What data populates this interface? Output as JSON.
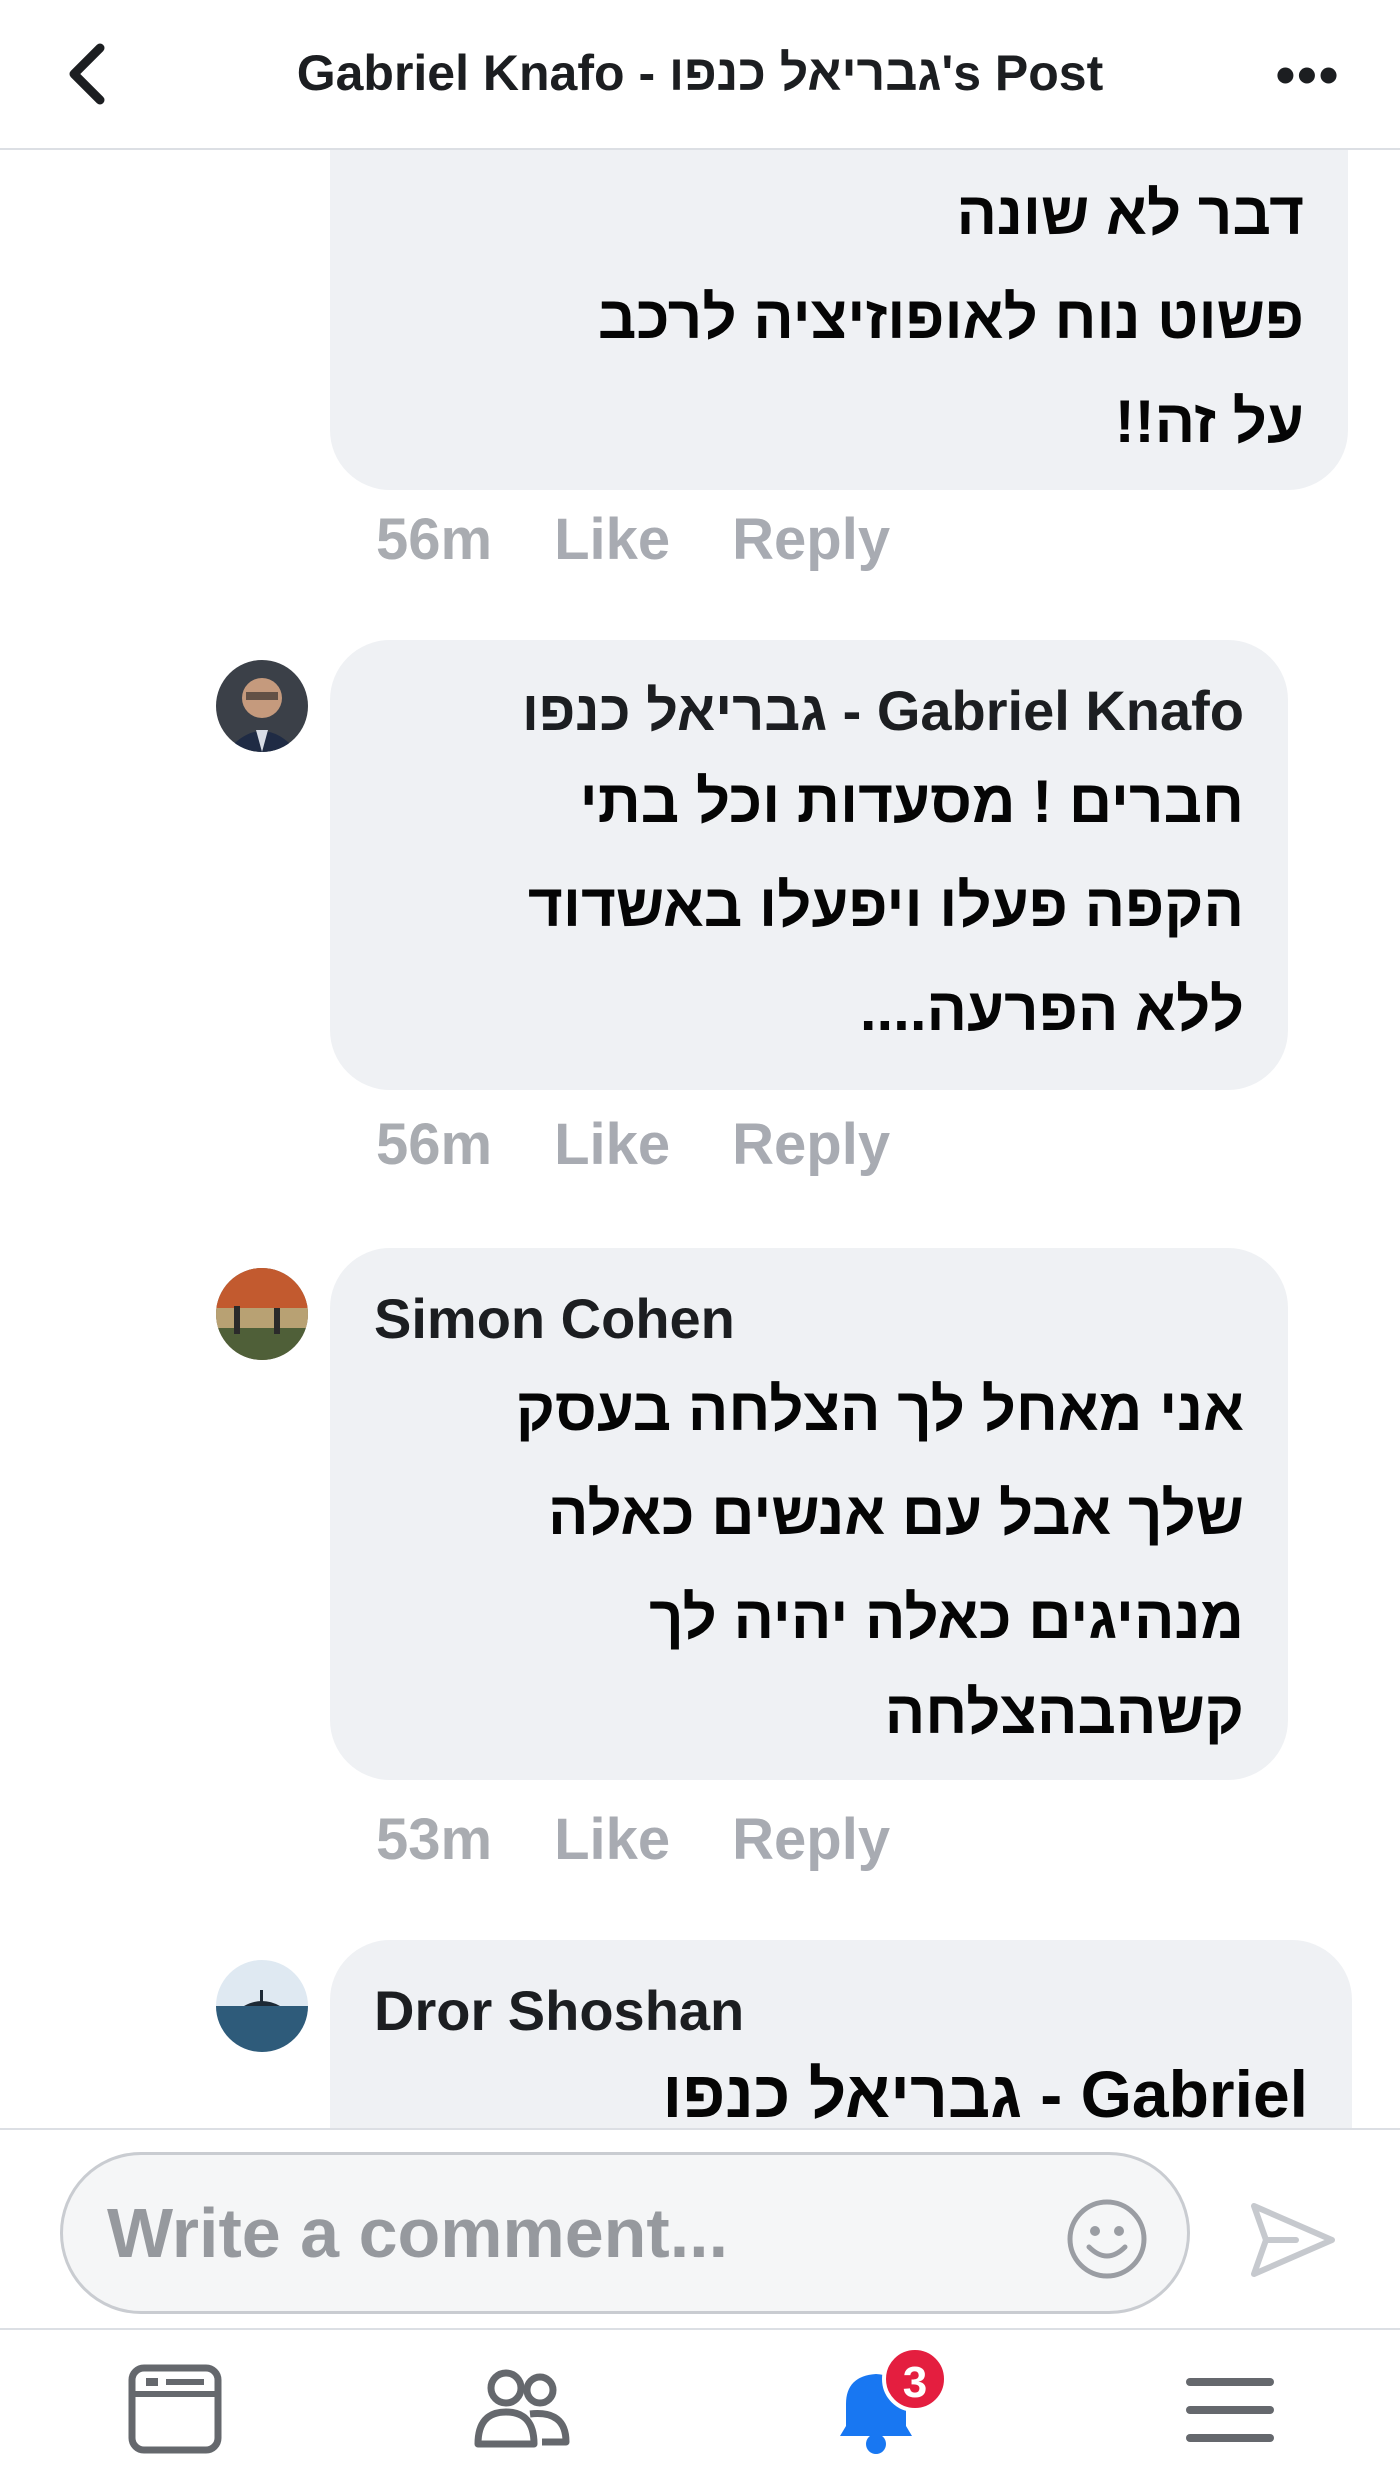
{
  "header": {
    "title": "Gabriel Knafo - גבריאל כנפו's Post",
    "back_icon": "chevron-left-icon",
    "more_label": "•••"
  },
  "comments": [
    {
      "author": "",
      "lines": [
        "דבר לא שונה",
        "פשוט נוח לאופוזיציה לרכב",
        "על זה!!"
      ],
      "time": "56m",
      "like": "Like",
      "reply": "Reply"
    },
    {
      "author": "Gabriel Knafo - גבריאל כנפו",
      "lines": [
        "חברים ! מסעדות וכל בתי",
        "הקפה פעלו ויפעלו באשדוד",
        "ללא הפרעה...."
      ],
      "time": "56m",
      "like": "Like",
      "reply": "Reply"
    },
    {
      "author": "Simon Cohen",
      "lines": [
        "אני מאחל לך הצלחה בעסק",
        "שלך אבל עם אנשים כאלה",
        "מנהיגים כאלה יהיה לך",
        "קשהבהצלחה"
      ],
      "time": "53m",
      "like": "Like",
      "reply": "Reply"
    },
    {
      "author": "Dror Shoshan",
      "lines": [
        "Gabriel - גבריאל כנפו"
      ]
    }
  ],
  "composer": {
    "placeholder": "Write a comment...",
    "emoji_icon": "smiley-icon",
    "send_icon": "send-icon"
  },
  "bottom_nav": {
    "items": [
      "news-feed-icon",
      "friends-icon",
      "notifications-bell-icon",
      "menu-icon"
    ],
    "notifications_badge": "3"
  },
  "colors": {
    "bubble": "#eff1f4",
    "action_text": "#a8abb2",
    "accent": "#1877f2",
    "badge": "#e41e3f"
  }
}
